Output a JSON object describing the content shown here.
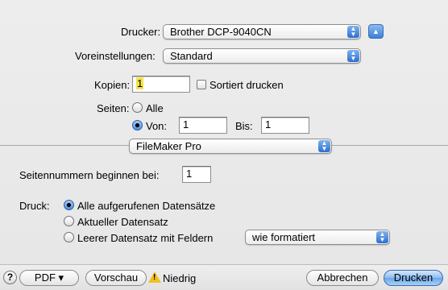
{
  "printer": {
    "label": "Drucker:",
    "value": "Brother DCP-9040CN"
  },
  "presets": {
    "label": "Voreinstellungen:",
    "value": "Standard"
  },
  "copies": {
    "label": "Kopien:",
    "value": "1",
    "collate_label": "Sortiert drucken"
  },
  "pages": {
    "label": "Seiten:",
    "all_label": "Alle",
    "from_label": "Von:",
    "from_value": "1",
    "to_label": "Bis:",
    "to_value": "1"
  },
  "panel_select": {
    "value": "FileMaker Pro"
  },
  "page_number": {
    "label": "Seitennummern beginnen bei:",
    "value": "1"
  },
  "print_records": {
    "label": "Druck:",
    "options": [
      "Alle aufgerufenen Datensätze",
      "Aktueller Datensatz",
      "Leerer Datensatz mit Feldern"
    ],
    "format_value": "wie formatiert"
  },
  "footer": {
    "help": "?",
    "pdf": "PDF ▾",
    "preview": "Vorschau",
    "supply_status": "Niedrig",
    "cancel": "Abbrechen",
    "print": "Drucken"
  },
  "colors": {
    "accent": "#3c7fd8",
    "warning": "#f0c020"
  }
}
